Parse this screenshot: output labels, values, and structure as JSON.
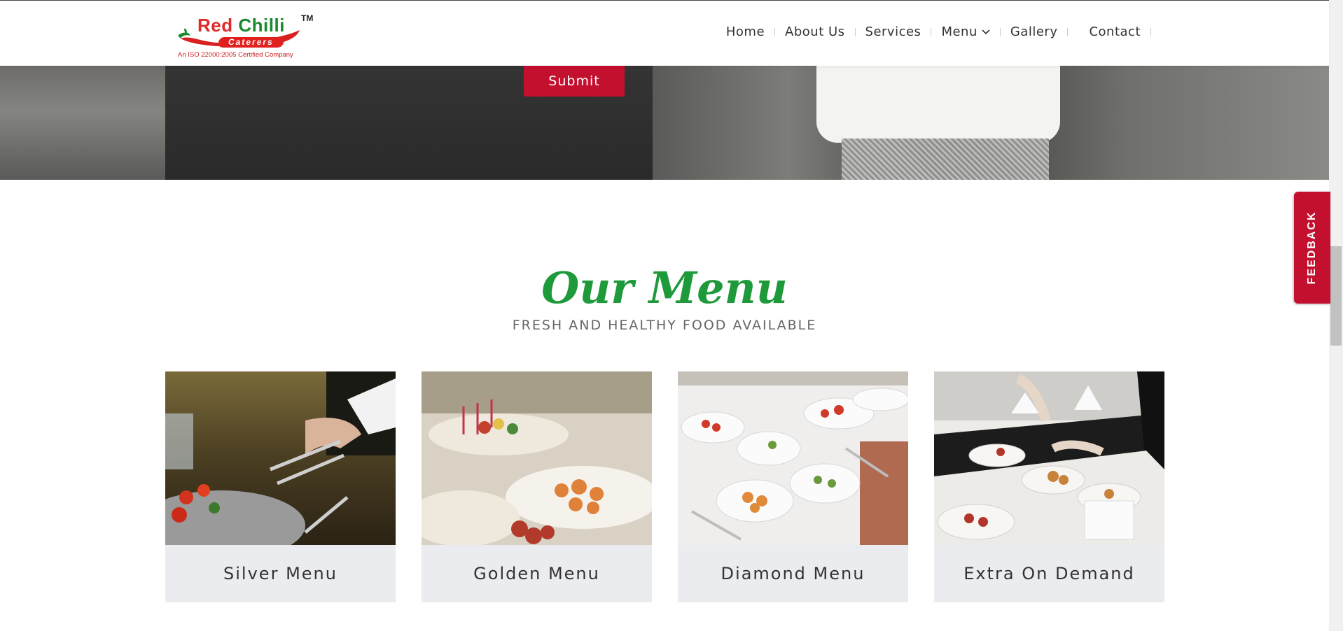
{
  "header": {
    "logo": {
      "brand_red": "Red",
      "brand_green": "Chilli",
      "tm": "TM",
      "sub": "Caterers",
      "iso": "An ISO 22000:2005 Certified Company"
    },
    "nav": [
      {
        "label": "Home"
      },
      {
        "label": "About Us"
      },
      {
        "label": "Services"
      },
      {
        "label": "Menu",
        "has_dropdown": true
      },
      {
        "label": "Gallery"
      },
      {
        "label": "Contact"
      }
    ]
  },
  "hero": {
    "submit_label": "Submit"
  },
  "feedback": {
    "label": "FEEDBACK"
  },
  "menu_section": {
    "title": "Our Menu",
    "subtitle": "FRESH AND HEALTHY FOOD AVAILABLE",
    "cards": [
      {
        "label": "Silver Menu"
      },
      {
        "label": "Golden Menu"
      },
      {
        "label": "Diamond Menu"
      },
      {
        "label": "Extra On Demand"
      }
    ]
  },
  "colors": {
    "brand_red": "#c4102f",
    "brand_green": "#1e9a3a",
    "card_bg": "#ebecf0"
  }
}
